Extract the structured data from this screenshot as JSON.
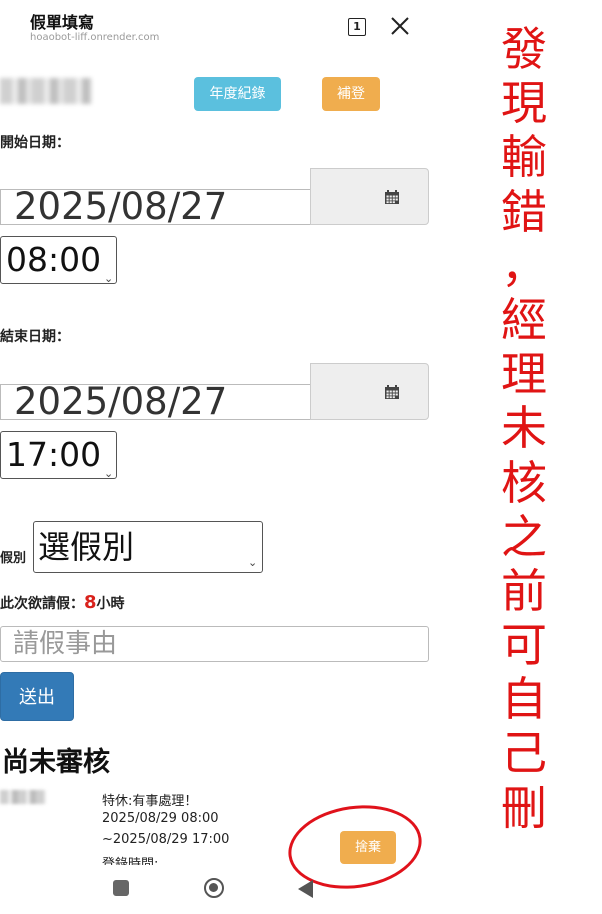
{
  "header": {
    "title": "假單填寫",
    "url": "hoaobot-liff.onrender.com",
    "tab_count": "1",
    "close_icon": "close-icon"
  },
  "toolbar": {
    "annual_record_label": "年度紀錄",
    "supplement_label": "補登"
  },
  "form": {
    "start_label": "開始日期：",
    "start_date": "2025/08/27",
    "start_time": "08:00",
    "end_label": "結束日期：",
    "end_date": "2025/08/27",
    "end_time": "17:00",
    "leave_type_label": "假別",
    "leave_type_value": "選假別",
    "hours_prefix": "此次欲請假：",
    "hours_value": "8",
    "hours_suffix": "小時",
    "reason_placeholder": "請假事由",
    "submit_label": "送出"
  },
  "pending": {
    "title": "尚未審核",
    "record": {
      "type_reason": "特休:有事處理！",
      "from": "2025/08/29 08:00",
      "to": "~2025/08/29 17:00",
      "login_time_label": "登錄時間:",
      "discard_label": "捨棄"
    }
  },
  "annotation": {
    "text": "發現輸錯，經理未核之前可自己刪",
    "color": "#e01414"
  },
  "colors": {
    "info": "#5bc0de",
    "warning": "#f0ad4e",
    "primary": "#337ab7",
    "hours_highlight": "#d9221c"
  }
}
